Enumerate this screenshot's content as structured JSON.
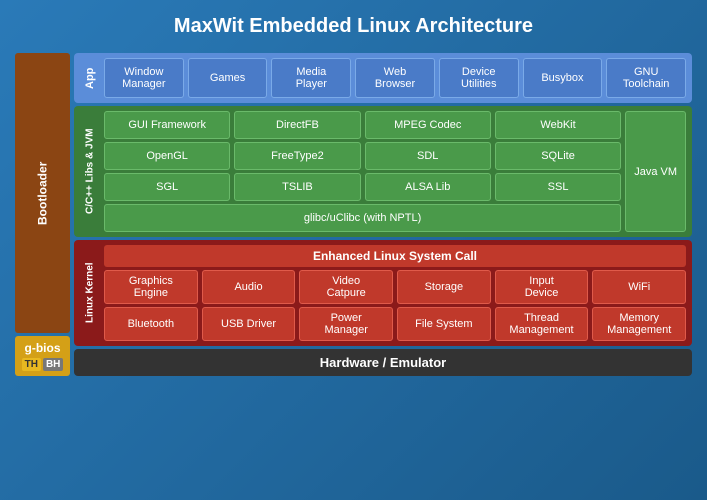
{
  "title": "MaxWit Embedded Linux Architecture",
  "app_layer": {
    "label": "App",
    "boxes": [
      {
        "id": "window-manager",
        "line1": "Window",
        "line2": "Manager"
      },
      {
        "id": "games",
        "line1": "Games",
        "line2": ""
      },
      {
        "id": "media-player",
        "line1": "Media",
        "line2": "Player"
      },
      {
        "id": "web-browser",
        "line1": "Web",
        "line2": "Browser"
      },
      {
        "id": "device-utilities",
        "line1": "Device",
        "line2": "Utilities"
      },
      {
        "id": "busybox",
        "line1": "Busybox",
        "line2": ""
      },
      {
        "id": "gnu-toolchain",
        "line1": "GNU",
        "line2": "Toolchain"
      }
    ]
  },
  "libs_layer": {
    "label": "C/C++ Libs & JVM",
    "row1": [
      {
        "id": "gui-framework",
        "text": "GUI Framework"
      },
      {
        "id": "directfb",
        "text": "DirectFB"
      },
      {
        "id": "mpeg-codec",
        "text": "MPEG Codec"
      },
      {
        "id": "webkit",
        "text": "WebKit"
      }
    ],
    "row2": [
      {
        "id": "opengl",
        "text": "OpenGL"
      },
      {
        "id": "freetype2",
        "text": "FreeType2"
      },
      {
        "id": "sdl",
        "text": "SDL"
      },
      {
        "id": "sqlite",
        "text": "SQLite"
      }
    ],
    "row3": [
      {
        "id": "sgl",
        "text": "SGL"
      },
      {
        "id": "tslib",
        "text": "TSLIB"
      },
      {
        "id": "alsa-lib",
        "text": "ALSA Lib"
      },
      {
        "id": "ssl",
        "text": "SSL"
      }
    ],
    "row4": [
      {
        "id": "glibc",
        "text": "glibc/uClibc (with NPTL)"
      }
    ],
    "javavm": "Java VM"
  },
  "kernel_layer": {
    "label": "Linux Kernel",
    "title": "Enhanced Linux System Call",
    "row1": [
      {
        "id": "graphics-engine",
        "line1": "Graphics",
        "line2": "Engine"
      },
      {
        "id": "audio",
        "line1": "Audio",
        "line2": ""
      },
      {
        "id": "video-capture",
        "line1": "Video",
        "line2": "Catpure"
      },
      {
        "id": "storage",
        "line1": "Storage",
        "line2": ""
      },
      {
        "id": "input-device",
        "line1": "Input",
        "line2": "Device"
      },
      {
        "id": "wifi",
        "line1": "WiFi",
        "line2": ""
      }
    ],
    "row2": [
      {
        "id": "bluetooth",
        "line1": "Bluetooth",
        "line2": ""
      },
      {
        "id": "usb-driver",
        "line1": "USB Driver",
        "line2": ""
      },
      {
        "id": "power-manager",
        "line1": "Power",
        "line2": "Manager"
      },
      {
        "id": "file-system",
        "line1": "File System",
        "line2": ""
      },
      {
        "id": "thread-mgmt",
        "line1": "Thread",
        "line2": "Management"
      },
      {
        "id": "memory-mgmt",
        "line1": "Memory",
        "line2": "Management"
      }
    ]
  },
  "hardware": {
    "label": "Hardware / Emulator"
  },
  "bootloader": {
    "label": "Bootloader",
    "gbios": "g-bios",
    "th": "TH",
    "bh": "BH"
  }
}
